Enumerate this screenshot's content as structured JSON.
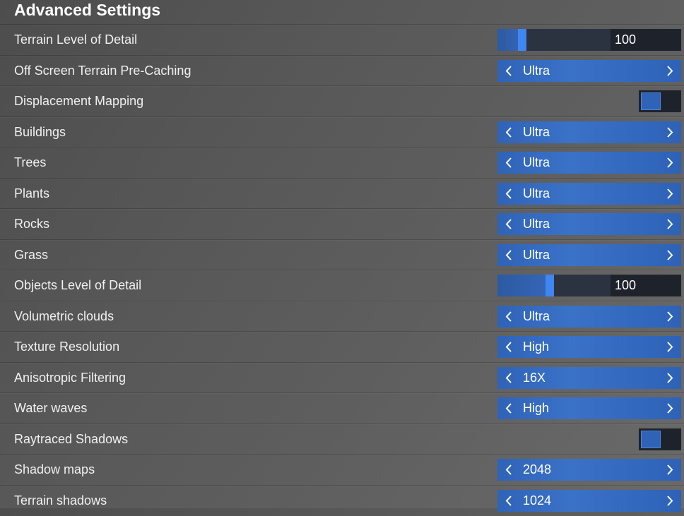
{
  "section": {
    "title": "Advanced Settings"
  },
  "colors": {
    "accent": "#3a72c8",
    "handle": "#3f86f0",
    "dark_box": "#1e232b"
  },
  "icons": {
    "prev": "chevron-left-icon",
    "next": "chevron-right-icon"
  },
  "rows": [
    {
      "label": "Terrain Level of Detail",
      "type": "slider",
      "value": "100",
      "level_percent": 22
    },
    {
      "label": "Off Screen Terrain Pre-Caching",
      "type": "select",
      "value": "Ultra"
    },
    {
      "label": "Displacement Mapping",
      "type": "toggle",
      "on": true
    },
    {
      "label": "Buildings",
      "type": "select",
      "value": "Ultra"
    },
    {
      "label": "Trees",
      "type": "select",
      "value": "Ultra"
    },
    {
      "label": "Plants",
      "type": "select",
      "value": "Ultra"
    },
    {
      "label": "Rocks",
      "type": "select",
      "value": "Ultra"
    },
    {
      "label": "Grass",
      "type": "select",
      "value": "Ultra"
    },
    {
      "label": "Objects Level of Detail",
      "type": "slider",
      "value": "100",
      "level_percent": 46
    },
    {
      "label": "Volumetric clouds",
      "type": "select",
      "value": "Ultra"
    },
    {
      "label": "Texture Resolution",
      "type": "select",
      "value": "High"
    },
    {
      "label": "Anisotropic Filtering",
      "type": "select",
      "value": "16X"
    },
    {
      "label": "Water waves",
      "type": "select",
      "value": "High"
    },
    {
      "label": "Raytraced Shadows",
      "type": "toggle",
      "on": true
    },
    {
      "label": "Shadow maps",
      "type": "select",
      "value": "2048"
    },
    {
      "label": "Terrain shadows",
      "type": "select",
      "value": "1024"
    }
  ]
}
